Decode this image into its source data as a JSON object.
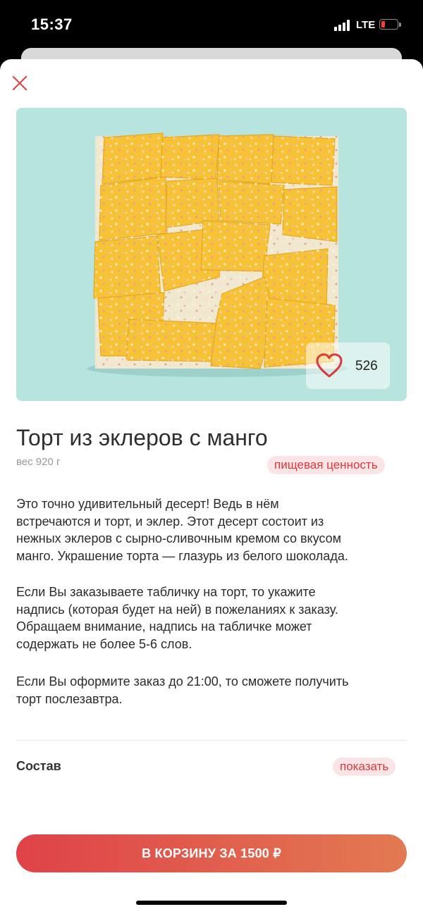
{
  "status_bar": {
    "time": "15:37",
    "network": "LTE"
  },
  "product": {
    "title": "Торт из эклеров с манго",
    "weight": "вес 920 г",
    "likes": "526",
    "nutrition_link": "пищевая ценность",
    "description": [
      [
        "Это точно удивительный десерт! Ведь в нём",
        "встречаются и торт, и эклер. Этот десерт состоит из",
        "нежных эклеров с сырно-сливочным кремом со вкусом",
        "манго. Украшение торта — глазурь из белого шоколада."
      ],
      [
        "Если Вы заказываете табличку на торт, то укажите",
        "надпись (которая будет на ней) в пожеланиях к заказу.",
        "Обращаем внимание, надпись на табличке может",
        "содержать не более 5-6 слов."
      ],
      [
        "Если Вы оформите заказ до 21:00, то сможете получить",
        "торт послезавтра."
      ]
    ],
    "composition_label": "Состав",
    "composition_show": "показать",
    "cart_button": "В КОРЗИНУ ЗА 1500 ₽"
  },
  "colors": {
    "accent": "#e03a3f",
    "photo_bg": "#b7e4de",
    "cake": "#f7c236"
  },
  "icons": {
    "close": "close-icon",
    "like": "heart-icon"
  }
}
